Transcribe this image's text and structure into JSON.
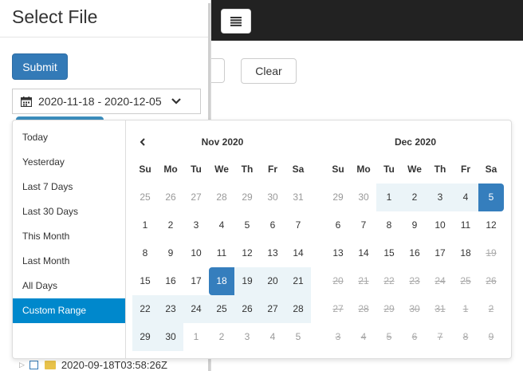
{
  "sidebar": {
    "title": "Select File",
    "submit_label": "Submit",
    "date_range_text": "2020-11-18 - 2020-12-05",
    "file_name": "2020-09-18T03:58:26Z"
  },
  "toolbar": {
    "clear_label": "Clear"
  },
  "icons": {
    "menu": "menu-icon",
    "calendar": "calendar-icon",
    "chevron": "chevron-down-icon",
    "prev": "chevron-left-icon",
    "folder": "folder-icon"
  },
  "colors": {
    "accent": "#337ab7",
    "range_active": "#0088cc",
    "in_range": "#ebf4f8",
    "navbar": "#222222"
  },
  "ranges": [
    "Today",
    "Yesterday",
    "Last 7 Days",
    "Last 30 Days",
    "This Month",
    "Last Month",
    "All Days",
    "Custom Range"
  ],
  "active_range": "Custom Range",
  "weekdays": [
    "Su",
    "Mo",
    "Tu",
    "We",
    "Th",
    "Fr",
    "Sa"
  ],
  "calendars": [
    {
      "month": "Nov 2020",
      "has_prev": true,
      "weeks": [
        [
          {
            "d": "25",
            "s": "off"
          },
          {
            "d": "26",
            "s": "off"
          },
          {
            "d": "27",
            "s": "off"
          },
          {
            "d": "28",
            "s": "off"
          },
          {
            "d": "29",
            "s": "off"
          },
          {
            "d": "30",
            "s": "off"
          },
          {
            "d": "31",
            "s": "off"
          }
        ],
        [
          {
            "d": "1"
          },
          {
            "d": "2"
          },
          {
            "d": "3"
          },
          {
            "d": "4"
          },
          {
            "d": "5"
          },
          {
            "d": "6"
          },
          {
            "d": "7"
          }
        ],
        [
          {
            "d": "8"
          },
          {
            "d": "9"
          },
          {
            "d": "10"
          },
          {
            "d": "11"
          },
          {
            "d": "12"
          },
          {
            "d": "13"
          },
          {
            "d": "14"
          }
        ],
        [
          {
            "d": "15"
          },
          {
            "d": "16"
          },
          {
            "d": "17"
          },
          {
            "d": "18",
            "s": "start"
          },
          {
            "d": "19",
            "s": "inrange"
          },
          {
            "d": "20",
            "s": "inrange"
          },
          {
            "d": "21",
            "s": "inrange"
          }
        ],
        [
          {
            "d": "22",
            "s": "inrange"
          },
          {
            "d": "23",
            "s": "inrange"
          },
          {
            "d": "24",
            "s": "inrange"
          },
          {
            "d": "25",
            "s": "inrange"
          },
          {
            "d": "26",
            "s": "inrange"
          },
          {
            "d": "27",
            "s": "inrange"
          },
          {
            "d": "28",
            "s": "inrange"
          }
        ],
        [
          {
            "d": "29",
            "s": "inrange"
          },
          {
            "d": "30",
            "s": "inrange"
          },
          {
            "d": "1",
            "s": "off"
          },
          {
            "d": "2",
            "s": "off"
          },
          {
            "d": "3",
            "s": "off"
          },
          {
            "d": "4",
            "s": "off"
          },
          {
            "d": "5",
            "s": "off"
          }
        ]
      ]
    },
    {
      "month": "Dec 2020",
      "has_prev": false,
      "weeks": [
        [
          {
            "d": "29",
            "s": "off"
          },
          {
            "d": "30",
            "s": "off"
          },
          {
            "d": "1",
            "s": "inrange"
          },
          {
            "d": "2",
            "s": "inrange"
          },
          {
            "d": "3",
            "s": "inrange"
          },
          {
            "d": "4",
            "s": "inrange"
          },
          {
            "d": "5",
            "s": "end"
          }
        ],
        [
          {
            "d": "6"
          },
          {
            "d": "7"
          },
          {
            "d": "8"
          },
          {
            "d": "9"
          },
          {
            "d": "10"
          },
          {
            "d": "11"
          },
          {
            "d": "12"
          }
        ],
        [
          {
            "d": "13"
          },
          {
            "d": "14"
          },
          {
            "d": "15"
          },
          {
            "d": "16"
          },
          {
            "d": "17"
          },
          {
            "d": "18"
          },
          {
            "d": "19",
            "s": "strike"
          }
        ],
        [
          {
            "d": "20",
            "s": "strike"
          },
          {
            "d": "21",
            "s": "strike"
          },
          {
            "d": "22",
            "s": "strike"
          },
          {
            "d": "23",
            "s": "strike"
          },
          {
            "d": "24",
            "s": "strike"
          },
          {
            "d": "25",
            "s": "strike"
          },
          {
            "d": "26",
            "s": "strike"
          }
        ],
        [
          {
            "d": "27",
            "s": "strike"
          },
          {
            "d": "28",
            "s": "strike"
          },
          {
            "d": "29",
            "s": "strike"
          },
          {
            "d": "30",
            "s": "strike"
          },
          {
            "d": "31",
            "s": "strike"
          },
          {
            "d": "1",
            "s": "strike"
          },
          {
            "d": "2",
            "s": "strike"
          }
        ],
        [
          {
            "d": "3",
            "s": "strike"
          },
          {
            "d": "4",
            "s": "strike"
          },
          {
            "d": "5",
            "s": "strike"
          },
          {
            "d": "6",
            "s": "strike"
          },
          {
            "d": "7",
            "s": "strike"
          },
          {
            "d": "8",
            "s": "strike"
          },
          {
            "d": "9",
            "s": "strike"
          }
        ]
      ]
    }
  ]
}
